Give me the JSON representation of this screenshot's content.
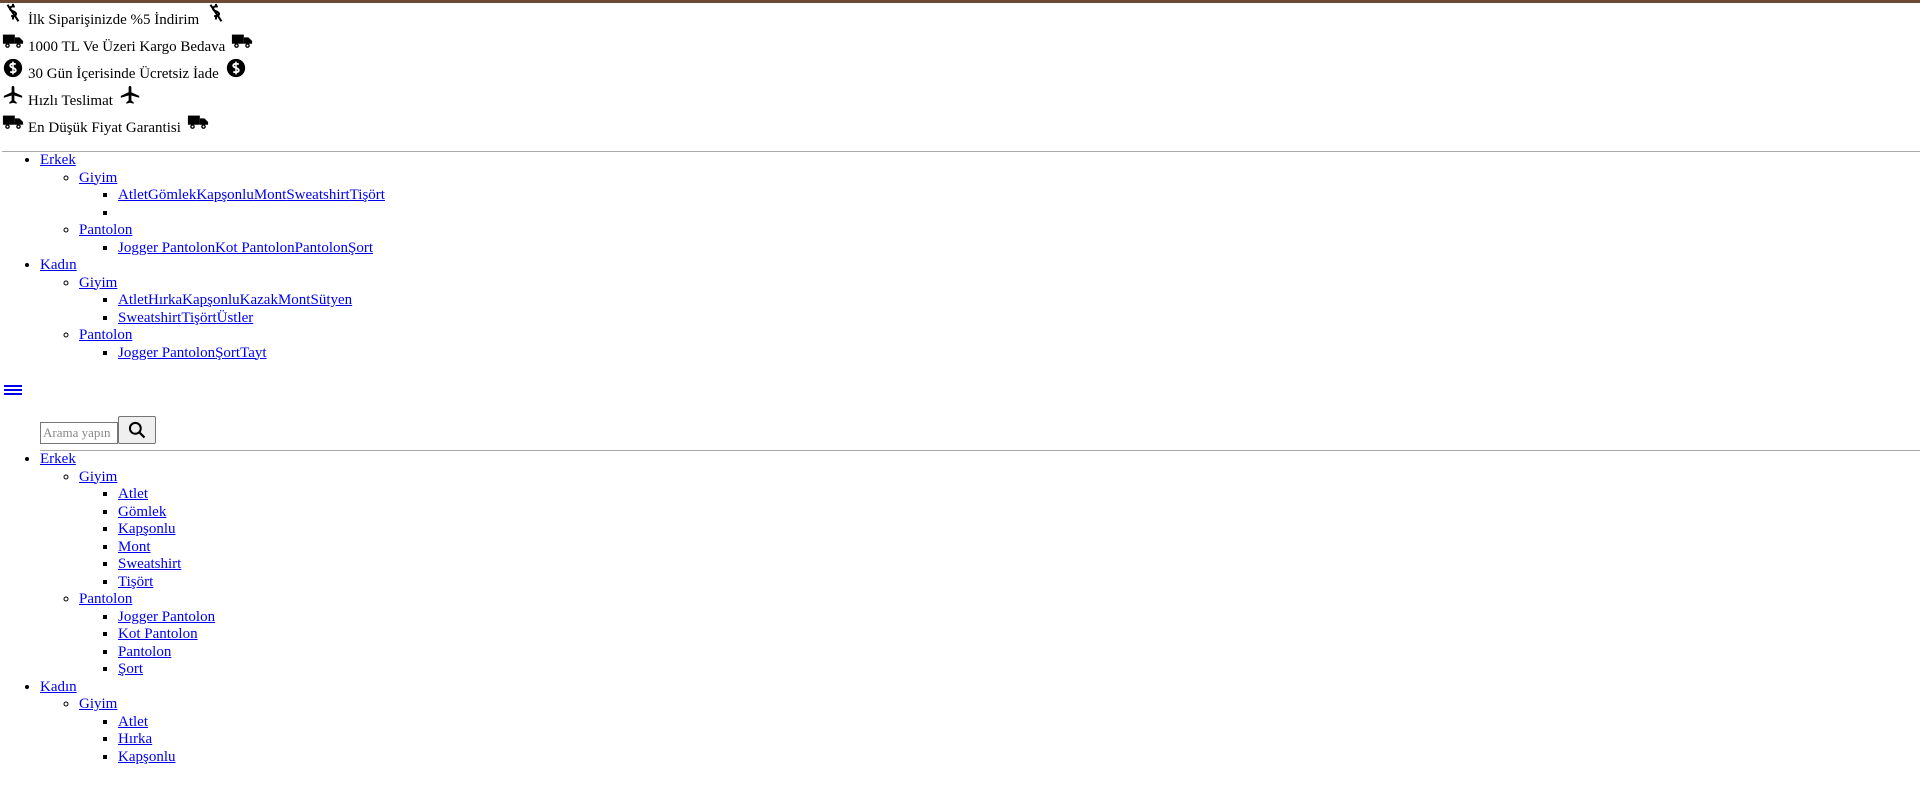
{
  "promos": [
    {
      "text": "İlk Siparişinizde %5 İndirim",
      "icon": "dollar-slash-icon"
    },
    {
      "text": "1000 TL Ve Üzeri Kargo Bedava",
      "icon": "truck-icon"
    },
    {
      "text": "30 Gün İçerisinde Ücretsiz İade",
      "icon": "dollar-circle-icon"
    },
    {
      "text": "Hızlı Teslimat",
      "icon": "plane-icon"
    },
    {
      "text": "En Düşük Fiyat Garantisi",
      "icon": "truck-icon"
    }
  ],
  "menu": {
    "erkek": "Erkek",
    "kadin": "Kadın",
    "giyim": "Giyim",
    "pantolon": "Pantolon",
    "erkek_giyim": [
      "Atlet",
      "Gömlek",
      "Kapşonlu",
      "Mont",
      "Sweatshirt",
      "Tişört"
    ],
    "erkek_pantolon": [
      "Jogger Pantolon",
      "Kot Pantolon",
      "Pantolon",
      "Şort"
    ],
    "kadin_giyim_row1": [
      "Atlet",
      "Hırka",
      "Kapşonlu",
      "Kazak",
      "Mont",
      "Sütyen"
    ],
    "kadin_giyim_row2": [
      "Sweatshirt",
      "Tişört",
      "Üstler"
    ],
    "kadin_pantolon": [
      "Jogger Pantolon",
      "Şort",
      "Tayt"
    ]
  },
  "search": {
    "placeholder": "Arama yapın"
  }
}
